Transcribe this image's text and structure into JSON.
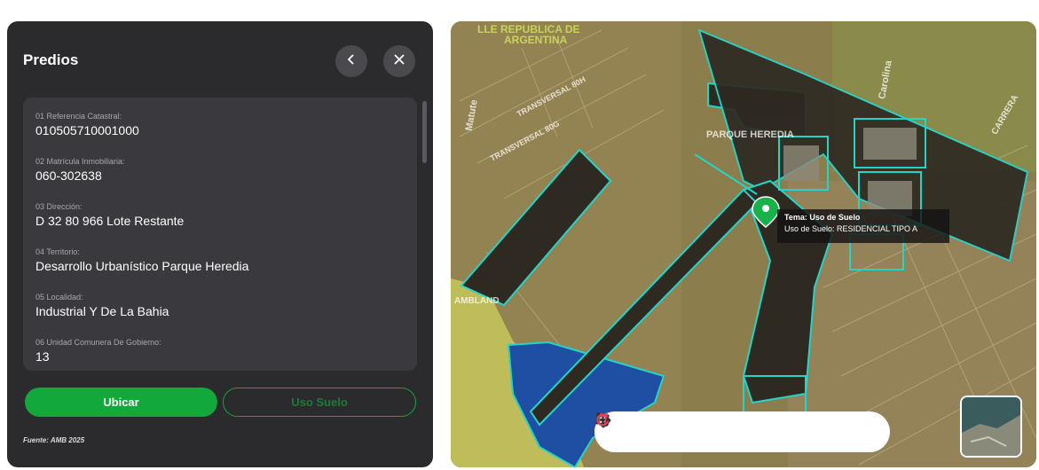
{
  "panel": {
    "title": "Predios",
    "fields": [
      {
        "label": "01 Referencia Catastral:",
        "value": "010505710001000"
      },
      {
        "label": "02 Matrícula Inmobiliaria:",
        "value": "060-302638"
      },
      {
        "label": "03 Dirección:",
        "value": "D 32 80 966 Lote Restante"
      },
      {
        "label": "04 Territorio:",
        "value": "Desarrollo Urbanístico Parque Heredia"
      },
      {
        "label": "05 Localidad:",
        "value": "Industrial Y De La Bahia"
      },
      {
        "label": "06 Unidad Comunera De Gobierno:",
        "value": "13"
      }
    ],
    "buttons": {
      "ubicar": "Ubicar",
      "uso_suelo": "Uso Suelo"
    },
    "source": "Fuente: AMB 2025"
  },
  "map": {
    "tooltip": {
      "title": "Tema: Uso de Suelo",
      "text": "Uso de Suelo: RESIDENCIAL TIPO A"
    },
    "labels": {
      "republica": "LLE REPUBLICA DE",
      "argentina": "ARGENTINA",
      "parque": "PARQUE HEREDIA",
      "carolina": "Carolina",
      "matute": "Matute",
      "transversal_1": "TRANSVERSAL 80H",
      "transversal_2": "TRANSVERSAL 80G",
      "amb_land": "AMBLAND",
      "carrera": "CARRERA"
    },
    "colors": {
      "parcel_outline": "#25d4c8",
      "parcel_fill": "#2e2a22",
      "blue_zone": "#1f4fa3",
      "yellow_zone": "#c8c84a",
      "marker": "#17b34a"
    },
    "toolbar": [
      "circle-tool",
      "zoom-in",
      "zoom-out",
      "pan",
      "polygon",
      "route",
      "delete",
      "refresh"
    ]
  }
}
